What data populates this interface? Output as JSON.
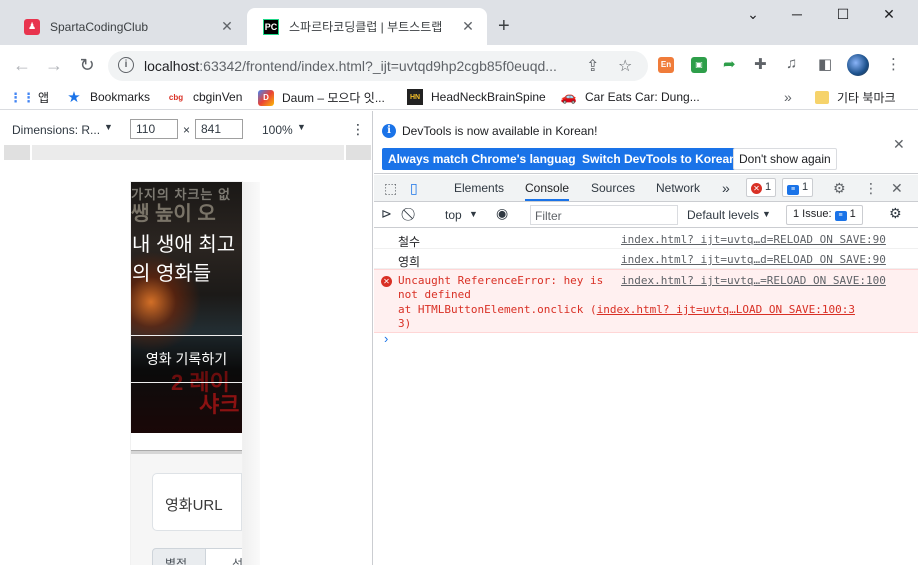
{
  "browser": {
    "tabs": [
      {
        "title": "SpartaCodingClub",
        "favicon": "sparta-icon",
        "active": false
      },
      {
        "title": "스파르타코딩클럽 | 부트스트랩",
        "favicon": "pycharm-icon",
        "active": true
      }
    ],
    "window_controls": {
      "chevron": "⌄",
      "minimize": "─",
      "maximize": "☐",
      "close": "✕"
    },
    "url": {
      "host": "localhost",
      "rest": ":63342/frontend/index.html?_ijt=uvtqd9hp2cgb85f0euqd..."
    },
    "extensions": [
      {
        "name": "ext-dict-icon",
        "label": "En",
        "color": "#f07c3a"
      },
      {
        "name": "ext-green-icon",
        "label": "▣",
        "color": "#2e9e4a"
      }
    ]
  },
  "bookmarks": [
    {
      "label": "앱",
      "icon": "apps-grid-icon"
    },
    {
      "label": "Bookmarks",
      "icon": "star-icon"
    },
    {
      "label": "cbginVen",
      "icon": "cbg-icon"
    },
    {
      "label": "Daum – 모으다 잇...",
      "icon": "daum-icon"
    },
    {
      "label": "HeadNeckBrainSpine",
      "icon": "hnbs-icon"
    },
    {
      "label": "Car Eats Car: Dung...",
      "icon": "car-icon"
    },
    {
      "label": "기타 북마크",
      "icon": "folder-icon"
    }
  ],
  "device_toolbar": {
    "dimensions_label": "Dimensions: R...",
    "width": "110",
    "times": "×",
    "height": "841",
    "zoom": "100%"
  },
  "page": {
    "poster_top": "가지의 차크는 없",
    "poster_top2": "쌩 높이 오",
    "headline": "내 생애 최고의 영화들",
    "record_button": "영화 기록하기",
    "poster_red": "2 레이",
    "poster_red2": "샤크",
    "url_placeholder": "영화URL",
    "star_label": "별점",
    "star_select": "선"
  },
  "devtools": {
    "info_message": "DevTools is now available in Korean!",
    "btn_match": "Always match Chrome's language",
    "btn_switch": "Switch DevTools to Korean",
    "btn_dont_show": "Don't show again",
    "tabs": [
      "Elements",
      "Console",
      "Sources",
      "Network"
    ],
    "active_tab": "Console",
    "more_tabs": "»",
    "error_count": "1",
    "message_count": "1",
    "context": "top",
    "filter_placeholder": "Filter",
    "levels": "Default levels",
    "issues": "1 Issue:",
    "issues_count": "1",
    "console": {
      "logs": [
        {
          "text": "철수",
          "source": "index.html? ijt=uvtq…d=RELOAD ON SAVE:90"
        },
        {
          "text": "영희",
          "source": "index.html? ijt=uvtq…d=RELOAD ON SAVE:90"
        }
      ],
      "error": {
        "line1": "Uncaught ReferenceError: hey is",
        "line2": "not defined",
        "line3_prefix": "    at HTMLButtonElement.onclick (",
        "line3_link": "index.html? ijt=uvtq…LOAD ON SAVE:100:3",
        "line4": "3)",
        "source": "index.html? ijt=uvtq…=RELOAD ON SAVE:100"
      },
      "prompt": "›"
    }
  }
}
